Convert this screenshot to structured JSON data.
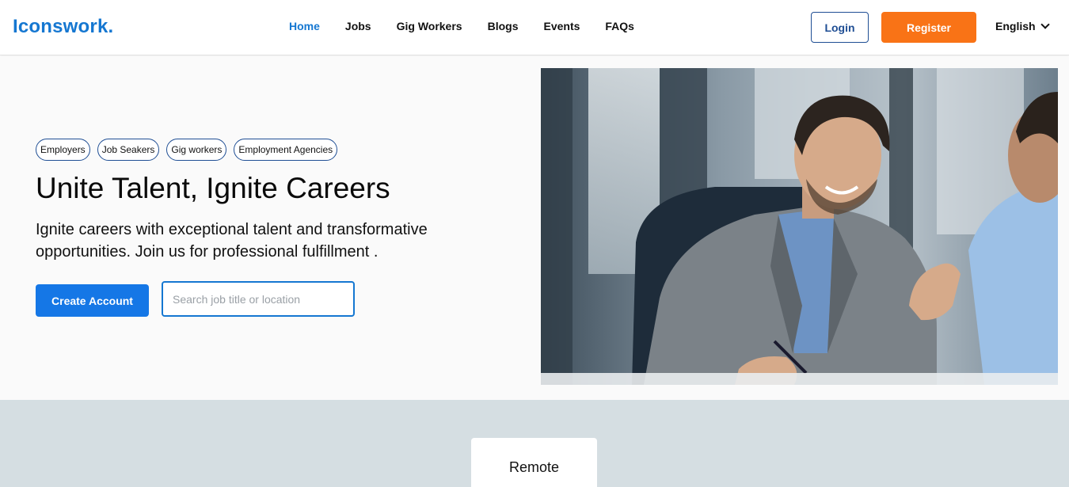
{
  "brand": {
    "logo": "Iconswork."
  },
  "nav": {
    "items": [
      {
        "label": "Home",
        "active": true
      },
      {
        "label": "Jobs",
        "active": false
      },
      {
        "label": "Gig Workers",
        "active": false
      },
      {
        "label": "Blogs",
        "active": false
      },
      {
        "label": "Events",
        "active": false
      },
      {
        "label": "FAQs",
        "active": false
      }
    ]
  },
  "header": {
    "login_label": "Login",
    "register_label": "Register",
    "language": "English"
  },
  "hero": {
    "tags": [
      "Employers",
      "Job Seakers",
      "Gig workers",
      "Employment Agencies"
    ],
    "title": "Unite Talent, Ignite Careers",
    "subtitle": "Ignite careers with exceptional talent and transformative opportunities. Join us for professional fulfillment .",
    "cta_label": "Create Account",
    "search_placeholder": "Search job title or location",
    "search_value": ""
  },
  "lower": {
    "card_label": "Remote"
  },
  "colors": {
    "brand_blue": "#1577d1",
    "register_orange": "#f97316",
    "cta_blue": "#1577e6",
    "lower_bg": "#d5dee2"
  }
}
